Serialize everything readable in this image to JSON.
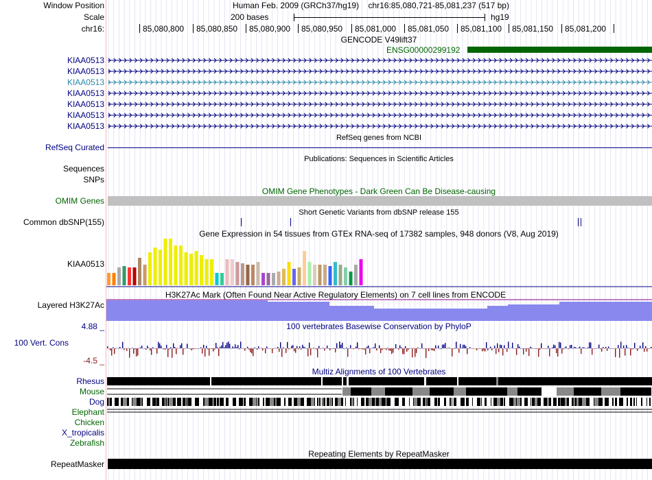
{
  "header": {
    "window_position_label": "Window Position",
    "scale_label": "Scale",
    "chrom_label": "chr16:",
    "assembly": "Human Feb. 2009 (GRCh37/hg19)",
    "position": "chr16:85,080,721-85,081,237 (517 bp)",
    "scale_text": "200 bases",
    "db": "hg19",
    "ruler_ticks": [
      "85,080,800",
      "85,080,850",
      "85,080,900",
      "85,080,950",
      "85,081,000",
      "85,081,050",
      "85,081,100",
      "85,081,150",
      "85,081,200"
    ]
  },
  "gencode": {
    "title": "GENCODE V49lift37",
    "ensg": "ENSG00000299192",
    "genes": [
      "KIAA0513",
      "KIAA0513",
      "KIAA0513",
      "KIAA0513",
      "KIAA0513",
      "KIAA0513",
      "KIAA0513"
    ]
  },
  "refseq": {
    "label": "RefSeq Curated",
    "title": "RefSeq genes from NCBI"
  },
  "publications": {
    "seq_label": "Sequences",
    "snp_label": "SNPs",
    "title": "Publications: Sequences in Scientific Articles"
  },
  "omim": {
    "label": "OMIM Genes",
    "title": "OMIM Gene Phenotypes - Dark Green Can Be Disease-causing"
  },
  "dbsnp": {
    "label": "Common dbSNP(155)",
    "title": "Short Genetic Variants from dbSNP release 155"
  },
  "gtex": {
    "label": "KIAA0513",
    "title": "Gene Expression in 54 tissues from GTEx RNA-seq of 17382 samples, 948 donors (V8, Aug 2019)"
  },
  "h3k27ac": {
    "label": "Layered H3K27Ac",
    "title": "H3K27Ac Mark (Often Found Near Active Regulatory Elements) on 7 cell lines from ENCODE"
  },
  "phylop": {
    "label": "100 Vert. Cons",
    "max": "4.88 _",
    "min": "-4.5 _",
    "title": "100 vertebrates Basewise Conservation by PhyloP"
  },
  "multiz": {
    "title": "Multiz Alignments of 100 Vertebrates",
    "species": [
      "Rhesus",
      "Mouse",
      "Dog",
      "Elephant",
      "Chicken",
      "X_tropicalis",
      "Zebrafish"
    ]
  },
  "repeatmasker": {
    "label": "RepeatMasker",
    "title": "Repeating Elements by RepeatMasker"
  },
  "colors": {
    "navy": "#000080",
    "green": "#006400",
    "gencode_bar": "#006400",
    "omim_bar": "#c0c0c0",
    "h3k27ac_fill": "#8888ee",
    "h3k27ac_line": "#800080"
  }
}
